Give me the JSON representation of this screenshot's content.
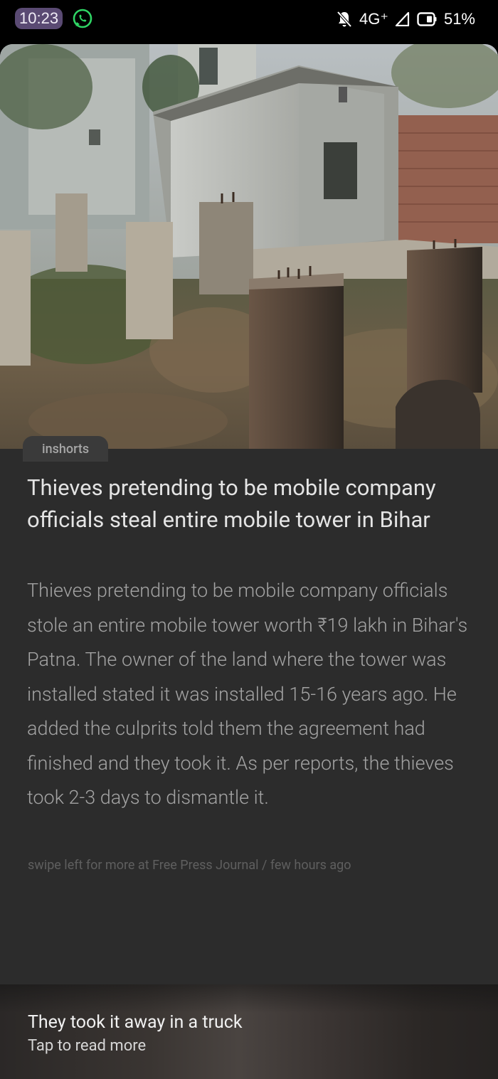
{
  "status_bar": {
    "time": "10:23",
    "network": "4G⁺",
    "battery": "51%",
    "icons": [
      "whatsapp-icon",
      "bell-off-icon",
      "signal-icon",
      "battery-saver-icon"
    ]
  },
  "article": {
    "brand": "inshorts",
    "headline": "Thieves pretending to be mobile company officials steal entire mobile tower in Bihar",
    "body": "Thieves pretending to be mobile company officials stole an entire mobile tower worth ₹19 lakh in Bihar's Patna. The owner of the land where the tower was installed stated it was installed 15-16 years ago. He added the culprits told them the agreement had finished and they took it. As per reports, the thieves took 2-3 days to dismantle it.",
    "source": "swipe left for more at Free Press Journal / few hours ago"
  },
  "bottom_bar": {
    "title": "They took it away in a truck",
    "subtitle": "Tap to read more"
  },
  "colors": {
    "card_bg": "#2c2c2c",
    "time_pill": "#5a4a73",
    "whatsapp": "#25d366"
  }
}
